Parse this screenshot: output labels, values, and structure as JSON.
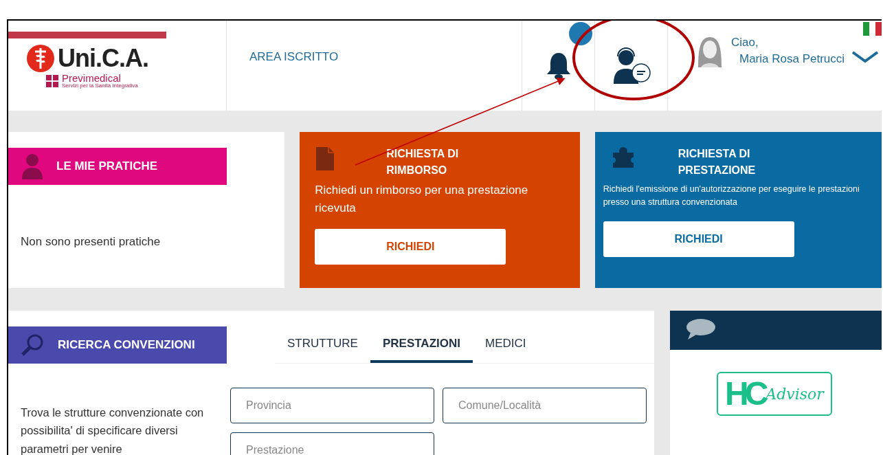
{
  "header": {
    "logo": {
      "name": "Uni.C.A.",
      "sub": "Previmedical",
      "tagline": "Servizi per la Sanità Integrativa"
    },
    "nav_link": "AREA ISCRITTO",
    "greeting": "Ciao,",
    "user_name": "Maria Rosa  Petrucci"
  },
  "practices": {
    "title": "LE MIE PRATICHE",
    "message": "Non sono presenti pratiche"
  },
  "request_cards": [
    {
      "kind": "document",
      "title": "RICHIESTA DI RIMBORSO",
      "description": "Richiedi un rimborso per una prestazione ricevuta",
      "button": "RICHIEDI",
      "color": "#d44400"
    },
    {
      "kind": "puzzle",
      "title": "RICHIESTA DI PRESTAZIONE",
      "description": "Richiedi l'emissione di un'autorizzazione per eseguire le prestazioni presso una struttura convenzionata",
      "button": "RICHIEDI",
      "color": "#0a6ba3"
    }
  ],
  "search": {
    "title": "RICERCA CONVENZIONI",
    "tabs": [
      {
        "label": "STRUTTURE",
        "selected": false
      },
      {
        "label": "PRESTAZIONI",
        "selected": true
      },
      {
        "label": "MEDICI",
        "selected": false
      }
    ],
    "description": "Trova le strutture convenzionate con possibilita' di specificare diversi parametri per venire",
    "fields": [
      {
        "placeholder": "Provincia"
      },
      {
        "placeholder": "Comune/Località"
      },
      {
        "placeholder": "Prestazione"
      }
    ]
  },
  "advisor": {
    "logo_letters": "HC",
    "logo_word": "Advisor"
  }
}
